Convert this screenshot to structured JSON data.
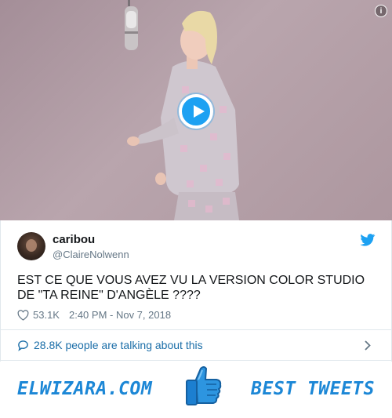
{
  "media": {
    "info_icon": "info-icon",
    "play_icon": "play-icon",
    "colors": {
      "background": "#b09ca4",
      "accent": "#1da1f2"
    }
  },
  "tweet": {
    "display_name": "caribou",
    "handle": "@ClaireNolwenn",
    "text": "EST CE QUE VOUS AVEZ VU LA VERSION COLOR STUDIO DE \"TA REINE\" D'ANGÈLE ????",
    "likes": "53.1K",
    "timestamp": "2:40 PM - Nov 7, 2018",
    "icons": {
      "bird": "twitter-bird-icon",
      "heart": "heart-icon"
    }
  },
  "conversation": {
    "label": "28.8K people are talking about this",
    "icons": {
      "bubble": "comment-icon",
      "chevron": "chevron-right-icon"
    }
  },
  "banner": {
    "left": "ELWIZARA.COM",
    "right": "BEST TWEETS",
    "icon": "thumbs-up-icon",
    "color": "#1c87d6"
  }
}
